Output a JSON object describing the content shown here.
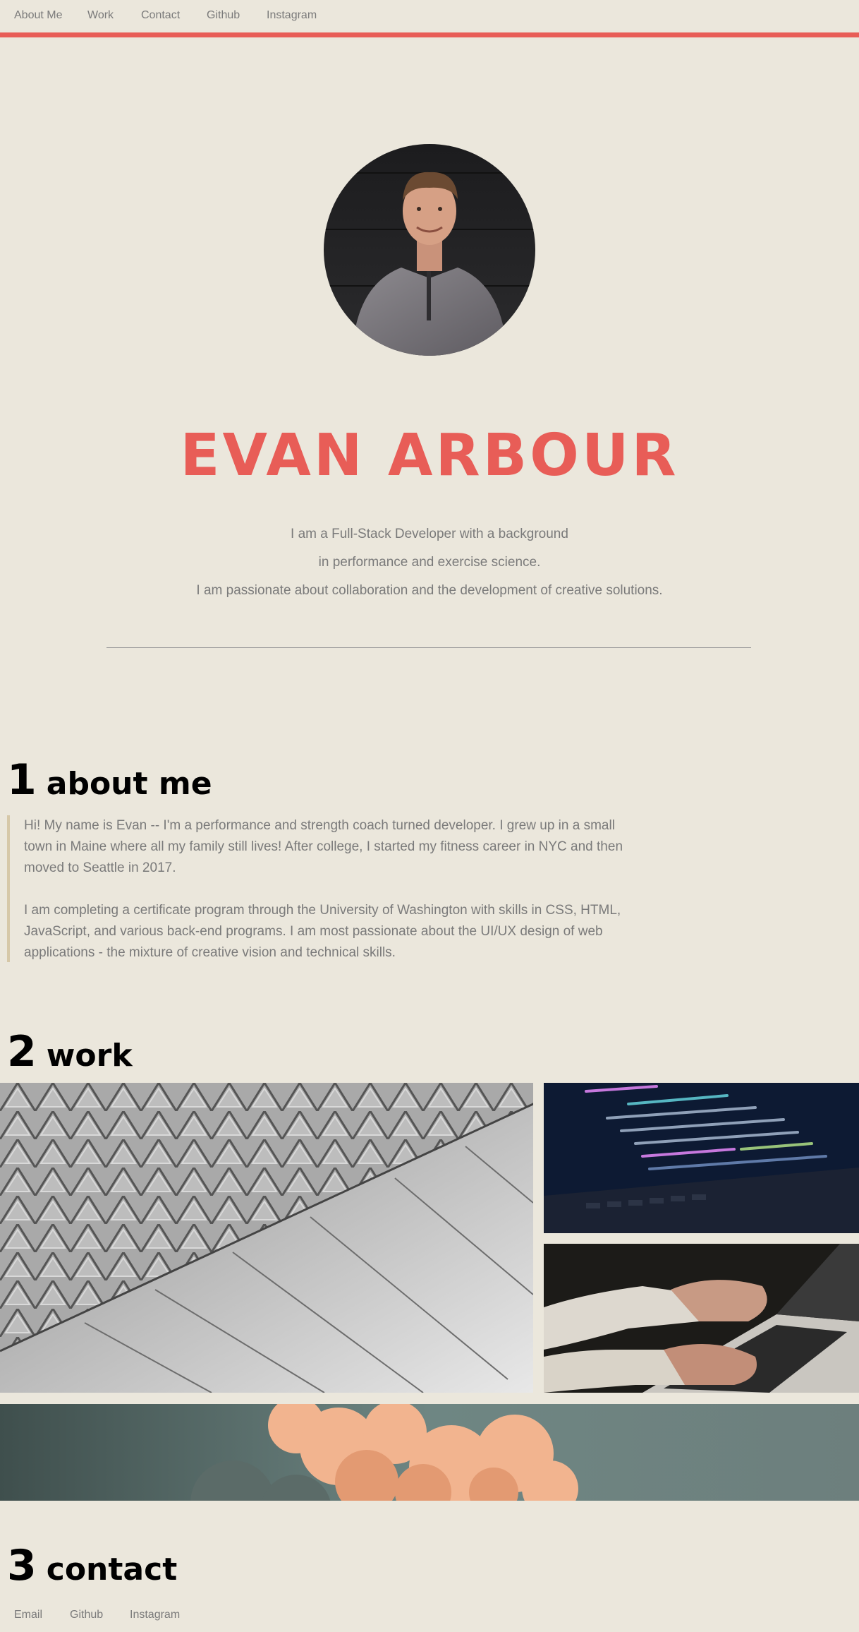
{
  "nav": {
    "items": [
      {
        "label": "About Me"
      },
      {
        "label": "Work"
      },
      {
        "label": "Contact"
      },
      {
        "label": "Github"
      },
      {
        "label": "Instagram"
      }
    ]
  },
  "hero": {
    "name": "EVAN ARBOUR",
    "intro_lines": [
      "I am a Full-Stack Developer with a background",
      "in performance and exercise science.",
      "I am passionate about collaboration and the development of creative solutions."
    ]
  },
  "about": {
    "number": "1",
    "title": "about me",
    "paragraphs": [
      "Hi! My name is Evan -- I'm a performance and strength coach turned developer. I grew up in a small town in Maine where all my family still lives! After college, I started my fitness career in NYC and then moved to Seattle in 2017.",
      "I am completing a certificate program through the University of Washington with skills in CSS, HTML, JavaScript, and various back-end programs. I am most passionate about the UI/UX design of web applications - the mixture of creative vision and technical skills."
    ]
  },
  "work": {
    "number": "2",
    "title": "work"
  },
  "contact": {
    "number": "3",
    "title": "contact",
    "links": [
      {
        "label": "Email"
      },
      {
        "label": "Github"
      },
      {
        "label": "Instagram"
      }
    ]
  },
  "colors": {
    "accent": "#e85d57",
    "background": "#ebe7dc",
    "text": "#7a7a7a",
    "quote_border": "#d6c8a8"
  }
}
